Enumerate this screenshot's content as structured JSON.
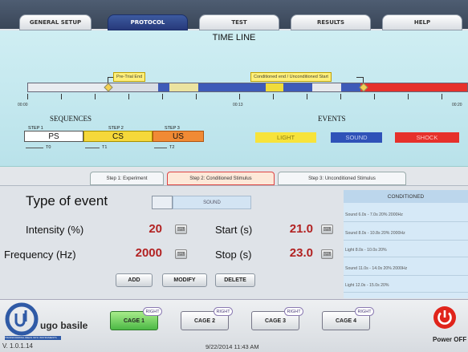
{
  "tabs": [
    {
      "label": "GENERAL SETUP"
    },
    {
      "label": "PROTOCOL",
      "active": true
    },
    {
      "label": "TEST"
    },
    {
      "label": "RESULTS"
    },
    {
      "label": "HELP"
    }
  ],
  "timeline": {
    "title": "TIME LINE",
    "marker_pretrial": "Pre-Trial End",
    "marker_conditioned": "Conditioned end / Unconditioned Start",
    "axis_labels": [
      "00:00",
      "00:13",
      "00:20"
    ]
  },
  "sequences": {
    "title": "SEQUENCES",
    "steps": [
      {
        "step": "STEP 1",
        "code": "PS",
        "t": "T0",
        "color": "#ffffff"
      },
      {
        "step": "STEP 2",
        "code": "CS",
        "t": "T1",
        "color": "#f5d83a"
      },
      {
        "step": "STEP 3",
        "code": "US",
        "t": "T2",
        "color": "#f08a35"
      }
    ]
  },
  "events": {
    "title": "EVENTS",
    "items": [
      {
        "label": "LIGHT",
        "bg": "#f7e33a",
        "fg": "#8a7a10"
      },
      {
        "label": "SOUND",
        "bg": "#2f52b8",
        "fg": "#c9d3f5"
      },
      {
        "label": "SHOCK",
        "bg": "#e6312b",
        "fg": "#ffc9c6"
      }
    ]
  },
  "step_tabs": [
    {
      "label": "Step 1: Experiment"
    },
    {
      "label": "Step 2: Conditioned Stimulus",
      "active": true
    },
    {
      "label": "Step 3: Unconditioned Stimulus"
    }
  ],
  "form": {
    "type_label": "Type of event",
    "type_value": "SOUND",
    "intensity_label": "Intensity (%)",
    "intensity_value": "20",
    "frequency_label": "Frequency (Hz)",
    "frequency_value": "2000",
    "start_label": "Start (s)",
    "start_value": "21.0",
    "stop_label": "Stop (s)",
    "stop_value": "23.0",
    "add_label": "ADD",
    "modify_label": "MODIFY",
    "delete_label": "DELETE"
  },
  "conditioned": {
    "header": "CONDITIONED",
    "rows": [
      "Sound 6.0s - 7.0s 20% 2000Hz",
      "Sound 8.0s - 10.8s 20% 2000Hz",
      "Light 8.0s - 10.0s 20%",
      "Sound 11.0s - 14.0s 20% 2000Hz",
      "Light 12.0s - 15.0s 20%"
    ]
  },
  "footer": {
    "brand": "ugo basile",
    "tagline": "TRANSFORMING IDEAS INTO INSTRUMENTS",
    "version": "V. 1.0.1.14",
    "datetime": "9/22/2014 11:43 AM",
    "power_label": "Power OFF",
    "cages": [
      {
        "label": "CAGE 1",
        "tag": "RIGHT",
        "active": true
      },
      {
        "label": "CAGE 2",
        "tag": "RIGHT"
      },
      {
        "label": "CAGE 3",
        "tag": "RIGHT"
      },
      {
        "label": "CAGE 4",
        "tag": "RIGHT"
      }
    ]
  }
}
